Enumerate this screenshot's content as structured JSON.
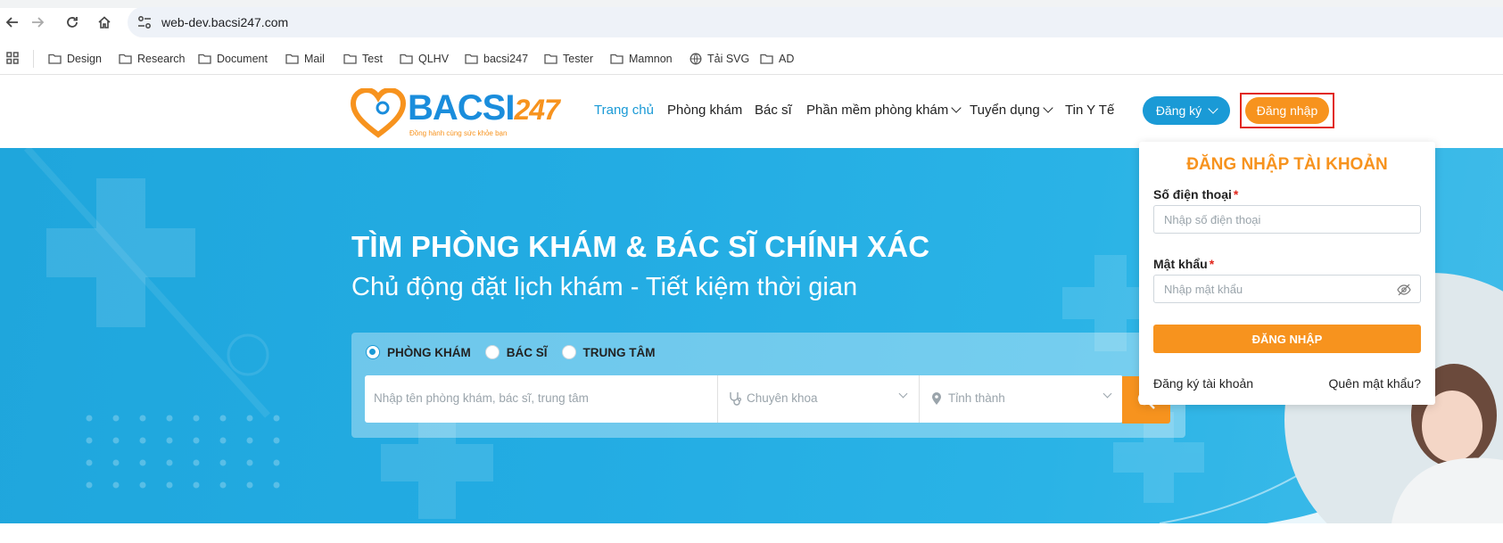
{
  "browser": {
    "url": "web-dev.bacsi247.com",
    "bookmarks": [
      {
        "label": "Design",
        "icon": "folder-icon"
      },
      {
        "label": "Research",
        "icon": "folder-icon"
      },
      {
        "label": "Document",
        "icon": "folder-icon"
      },
      {
        "label": "Mail",
        "icon": "folder-icon"
      },
      {
        "label": "Test",
        "icon": "folder-icon"
      },
      {
        "label": "QLHV",
        "icon": "folder-icon"
      },
      {
        "label": "bacsi247",
        "icon": "folder-icon"
      },
      {
        "label": "Tester",
        "icon": "folder-icon"
      },
      {
        "label": "Mamnon",
        "icon": "folder-icon"
      },
      {
        "label": "Tải SVG",
        "icon": "globe-icon"
      },
      {
        "label": "AD",
        "icon": "folder-icon"
      }
    ]
  },
  "header": {
    "logo_text": "BACSI",
    "logo_number": "247",
    "logo_tagline": "Đồng hành cùng sức khỏe bạn",
    "menu": [
      {
        "label": "Trang chủ",
        "active": true
      },
      {
        "label": "Phòng khám"
      },
      {
        "label": "Bác sĩ"
      },
      {
        "label": "Phần mềm phòng khám"
      },
      {
        "label": "Tuyển dụng"
      },
      {
        "label": "Tin Y Tế"
      }
    ],
    "register_label": "Đăng ký",
    "login_label": "Đăng nhập"
  },
  "hero": {
    "title": "TÌM PHÒNG KHÁM & BÁC SĨ CHÍNH XÁC",
    "subtitle": "Chủ động đặt lịch khám - Tiết kiệm thời gian",
    "search_types": [
      {
        "label": "PHÒNG KHÁM",
        "checked": true
      },
      {
        "label": "BÁC SĨ",
        "checked": false
      },
      {
        "label": "TRUNG TÂM",
        "checked": false
      }
    ],
    "search_placeholder": "Nhập tên phòng khám, bác sĩ, trung tâm",
    "specialty_placeholder": "Chuyên khoa",
    "province_placeholder": "Tỉnh thành"
  },
  "login_panel": {
    "title": "ĐĂNG NHẬP TÀI KHOẢN",
    "phone_label": "Số điện thoại",
    "phone_placeholder": "Nhập số điện thoại",
    "password_label": "Mật khẩu",
    "password_placeholder": "Nhập mật khẩu",
    "required_mark": "*",
    "submit_label": "ĐĂNG NHẬP",
    "register_link": "Đăng ký tài khoản",
    "forgot_link": "Quên mật khẩu?"
  },
  "colors": {
    "brand_blue": "#1a9ad6",
    "brand_orange": "#f7931e",
    "highlight_red": "#e1261c"
  }
}
